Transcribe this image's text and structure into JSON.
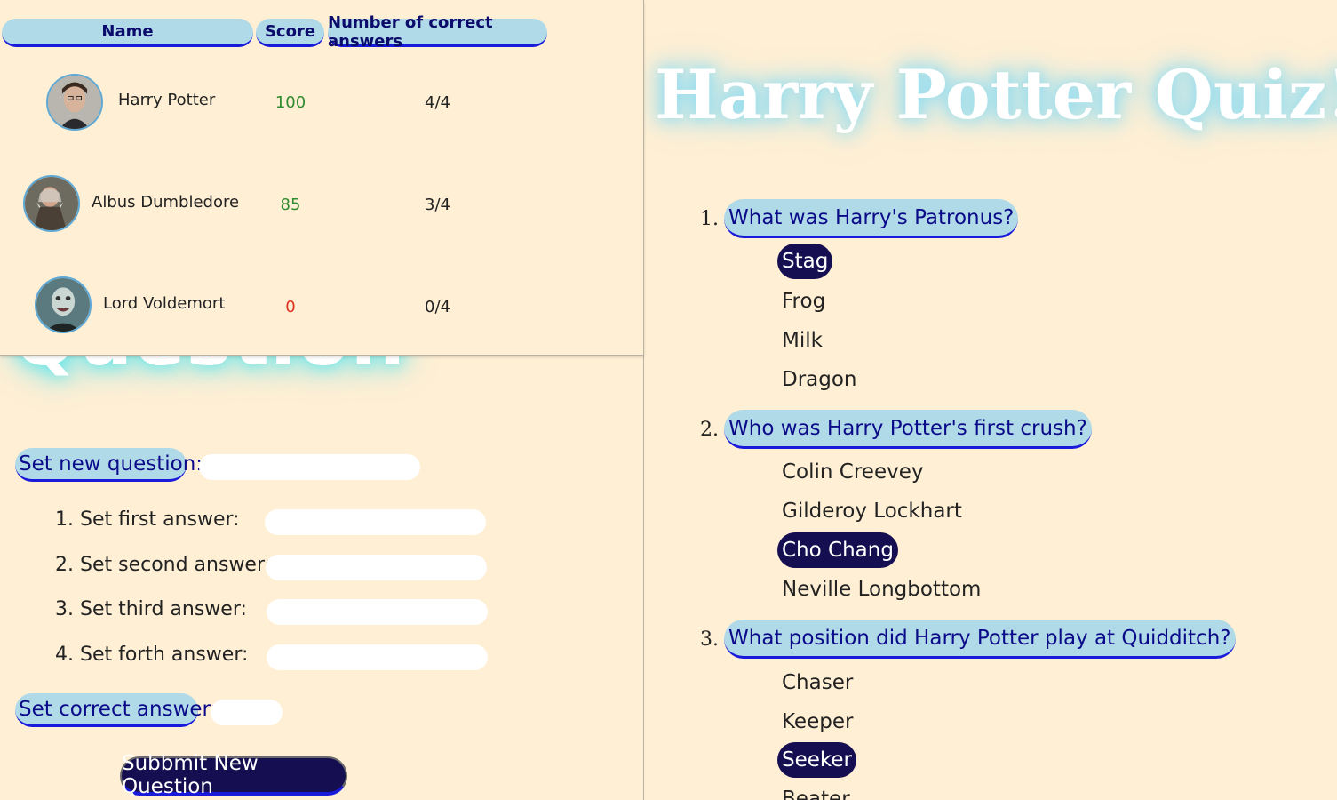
{
  "leaderboard": {
    "headers": {
      "name": "Name",
      "score": "Score",
      "correct": "Number of correct answers"
    },
    "rows": [
      {
        "name": "Harry Potter",
        "score": "100",
        "correct": "4/4",
        "score_color": "#2e8b2e",
        "avatar": "harry-potter-avatar"
      },
      {
        "name": "Albus Dumbledore",
        "score": "85",
        "correct": "3/4",
        "score_color": "#2e8b2e",
        "avatar": "albus-dumbledore-avatar"
      },
      {
        "name": "Lord Voldemort",
        "score": "0",
        "correct": "0/4",
        "score_color": "#e0301e",
        "avatar": "lord-voldemort-avatar"
      }
    ]
  },
  "form": {
    "ghost_title": "Question",
    "set_question_label": "Set new question:",
    "answers": [
      {
        "label": "1. Set first answer:"
      },
      {
        "label": "2. Set second answer:"
      },
      {
        "label": "3. Set third answer:"
      },
      {
        "label": "4. Set forth answer:"
      }
    ],
    "set_correct_label": "Set correct answer:",
    "submit_label": "Subbmit New Question"
  },
  "quiz": {
    "title": "Harry Potter Quiz!",
    "questions": [
      {
        "number": "1.",
        "text": "What was Harry's Patronus?",
        "options": [
          "Stag",
          "Frog",
          "Milk",
          "Dragon"
        ],
        "selected": "Stag"
      },
      {
        "number": "2.",
        "text": "Who was Harry Potter's first crush?",
        "options": [
          "Colin Creevey",
          "Gilderoy Lockhart",
          "Cho Chang",
          "Neville Longbottom"
        ],
        "selected": "Cho Chang"
      },
      {
        "number": "3.",
        "text": "What position did Harry Potter play at Quidditch?",
        "options": [
          "Chaser",
          "Keeper",
          "Seeker",
          "Beater"
        ],
        "selected": "Seeker"
      }
    ]
  },
  "colors": {
    "background": "#ffefd4",
    "pill": "#b0dae8",
    "pill_underline": "#1a1adb",
    "selected_bg": "#150f52",
    "score_good": "#2e8b2e",
    "score_bad": "#e0301e"
  }
}
